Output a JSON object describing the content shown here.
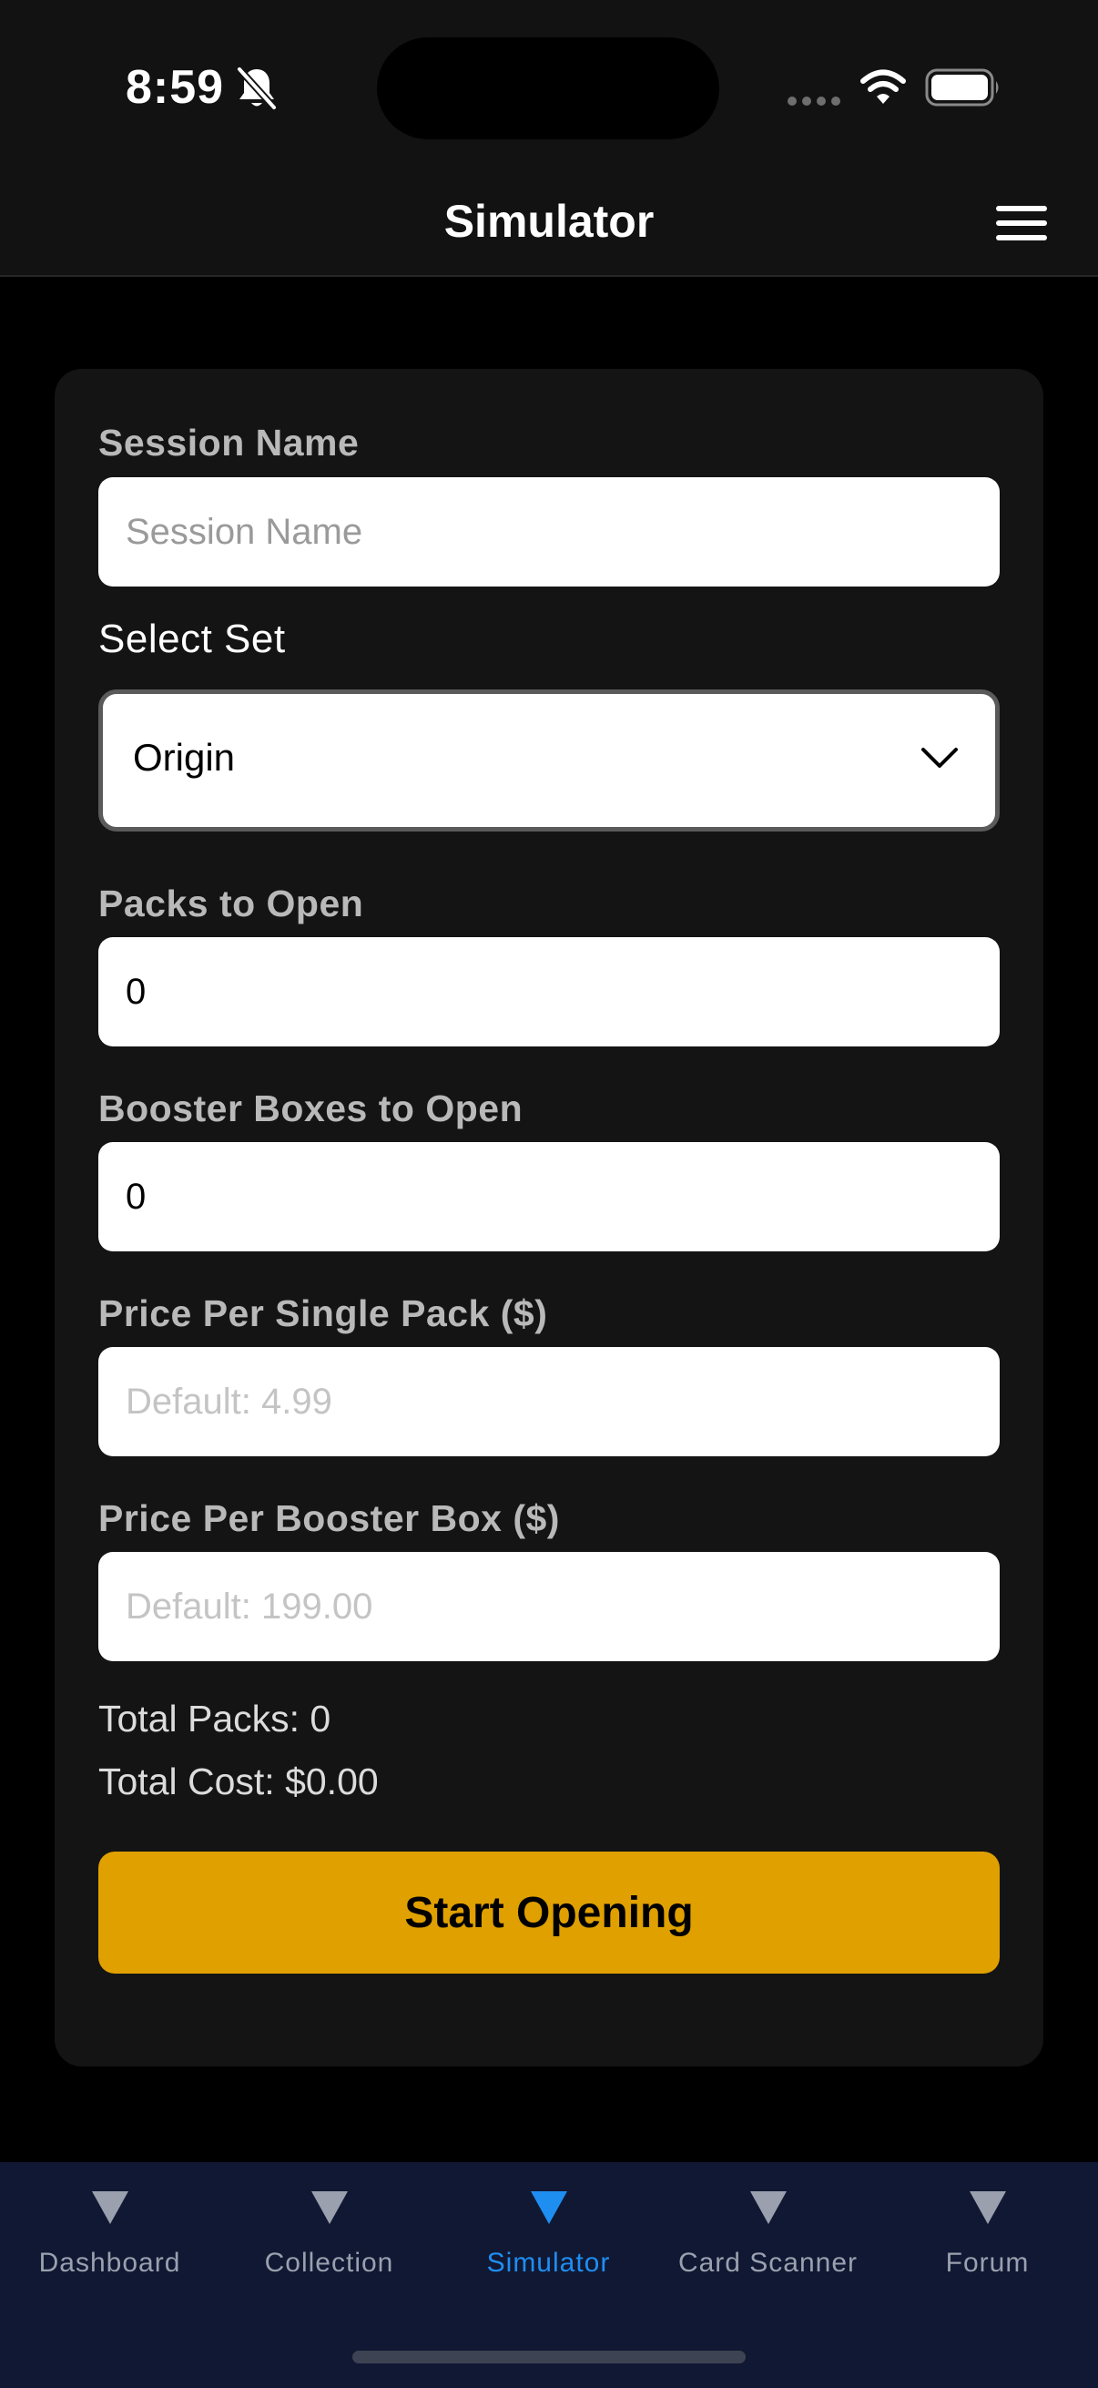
{
  "status_bar": {
    "time": "8:59"
  },
  "header": {
    "title": "Simulator"
  },
  "form": {
    "session_name": {
      "label": "Session Name",
      "value": "",
      "placeholder": "Session Name"
    },
    "select_set": {
      "label": "Select Set",
      "selected": "Origin"
    },
    "packs_to_open": {
      "label": "Packs to Open",
      "value": "0"
    },
    "booster_boxes_to_open": {
      "label": "Booster Boxes to Open",
      "value": "0"
    },
    "price_per_pack": {
      "label": "Price Per Single Pack ($)",
      "value": "",
      "placeholder": "Default: 4.99"
    },
    "price_per_box": {
      "label": "Price Per Booster Box ($)",
      "value": "",
      "placeholder": "Default: 199.00"
    }
  },
  "summary": {
    "total_packs": "Total Packs: 0",
    "total_cost": "Total Cost: $0.00"
  },
  "actions": {
    "start_label": "Start Opening"
  },
  "tab_bar": {
    "tabs": [
      {
        "label": "Dashboard",
        "icon": "triangle-down-icon",
        "active": false
      },
      {
        "label": "Collection",
        "icon": "triangle-down-icon",
        "active": false
      },
      {
        "label": "Simulator",
        "icon": "triangle-down-icon",
        "active": true
      },
      {
        "label": "Card Scanner",
        "icon": "triangle-down-icon",
        "active": false
      },
      {
        "label": "Forum",
        "icon": "triangle-down-icon",
        "active": false
      }
    ]
  },
  "colors": {
    "accent_button": "#dfa000",
    "active_tab": "#1f8ef1",
    "inactive_tab": "#9aa0ae",
    "tab_bar_bg": "#111833",
    "card_bg": "#141414"
  }
}
